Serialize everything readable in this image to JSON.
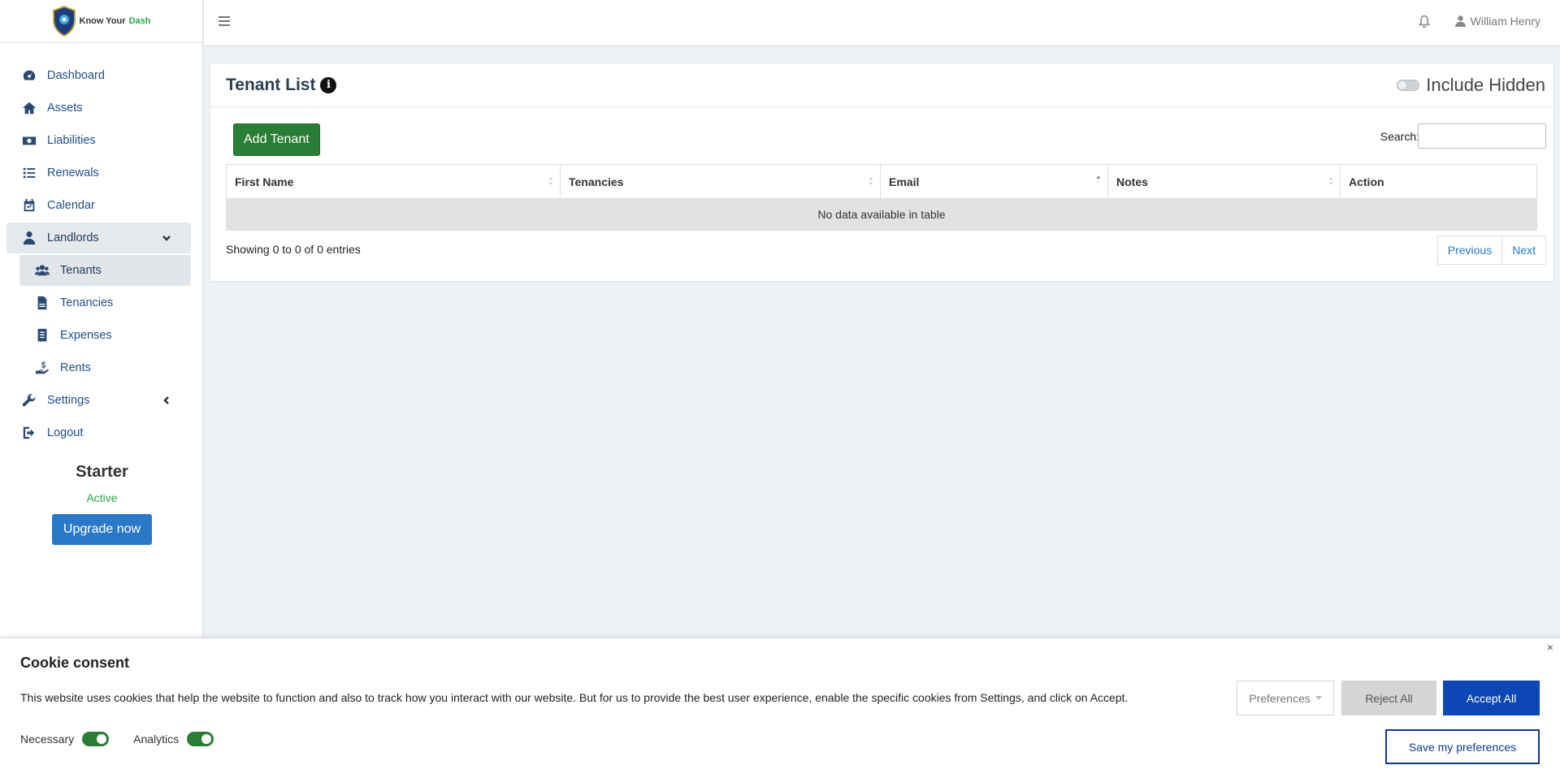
{
  "brand": {
    "name_prefix": "Know Your ",
    "name_accent": "Dash"
  },
  "topbar": {
    "user_name": "William Henry"
  },
  "sidebar": {
    "items": [
      {
        "label": "Dashboard",
        "icon": "gauge-icon"
      },
      {
        "label": "Assets",
        "icon": "home-icon"
      },
      {
        "label": "Liabilities",
        "icon": "money-bill-icon"
      },
      {
        "label": "Renewals",
        "icon": "list-icon"
      },
      {
        "label": "Calendar",
        "icon": "calendar-check-icon"
      },
      {
        "label": "Landlords",
        "icon": "user-tie-icon",
        "expanded": true
      },
      {
        "label": "Tenants",
        "icon": "users-icon",
        "active": true
      },
      {
        "label": "Tenancies",
        "icon": "file-contract-icon"
      },
      {
        "label": "Expenses",
        "icon": "receipt-icon"
      },
      {
        "label": "Rents",
        "icon": "hand-holding-dollar-icon"
      },
      {
        "label": "Settings",
        "icon": "wrench-icon"
      },
      {
        "label": "Logout",
        "icon": "sign-out-icon"
      }
    ],
    "plan": {
      "name": "Starter",
      "status": "Active",
      "upgrade_label": "Upgrade now"
    }
  },
  "main": {
    "title": "Tenant List",
    "include_hidden_label": "Include Hidden",
    "add_button_label": "Add Tenant",
    "search_label": "Search:",
    "search_value": "",
    "table": {
      "columns": [
        "First Name",
        "Tenancies",
        "Email",
        "Notes",
        "Action"
      ],
      "empty_message": "No data available in table"
    },
    "info": "Showing 0 to 0 of 0 entries",
    "pager": {
      "previous": "Previous",
      "next": "Next"
    }
  },
  "cookie": {
    "title": "Cookie consent",
    "text": "This website uses cookies that help the website to function and also to track how you interact with our website. But for us to provide the best user experience, enable the specific cookies from Settings, and click on Accept.",
    "toggles": [
      {
        "label": "Necessary",
        "on": true
      },
      {
        "label": "Analytics",
        "on": true
      }
    ],
    "preferences_label": "Preferences",
    "reject_label": "Reject All",
    "accept_label": "Accept All",
    "save_label": "Save my preferences",
    "close_glyph": "×"
  },
  "colors": {
    "primary": "#2a78c8",
    "success": "#2a7d35",
    "accept": "#0d47b5",
    "sidebar_text": "#1f4e89"
  }
}
